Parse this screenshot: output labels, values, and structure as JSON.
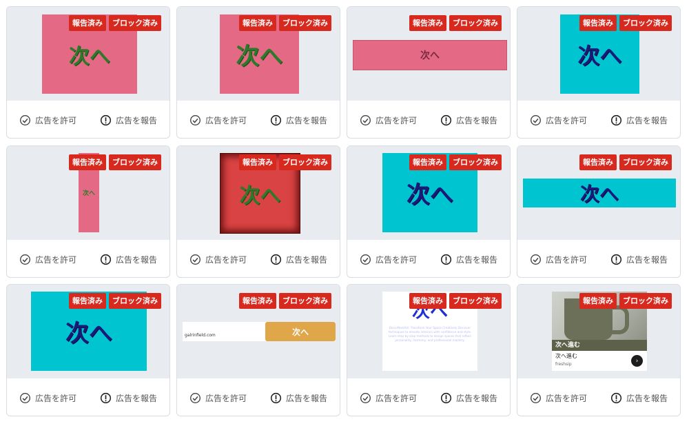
{
  "labels": {
    "reported": "報告済み",
    "blocked": "ブロック済み",
    "allow": "広告を許可",
    "report": "広告を報告"
  },
  "colors": {
    "badge": "#d8291f",
    "pink": "#e36984",
    "cyan": "#00c4cf",
    "preview_bg": "#e8ebef"
  },
  "icons": {
    "allow": "check-circle-icon",
    "report": "alert-circle-icon",
    "next": "chevron-right-icon"
  },
  "ads": [
    {
      "text": "次へ"
    },
    {
      "text": "次へ"
    },
    {
      "text": "次へ"
    },
    {
      "text": "次へ"
    },
    {
      "text": "次へ"
    },
    {
      "text": "次へ"
    },
    {
      "text": "次へ"
    },
    {
      "text": "次へ"
    },
    {
      "text": "次へ"
    },
    {
      "text": "次へ",
      "domain": "galrinfield.com"
    },
    {
      "text": "次へ",
      "body": "DecorNestArt: Transform Your Space Creatively Discover techniques to elevate interiors with confidence and style. Learn step-by-step methods to design spaces that reflect personality, harmony, and professional mastery."
    },
    {
      "overlay": "次へ進む",
      "title": "次へ進む",
      "brand": "freshsip"
    }
  ]
}
